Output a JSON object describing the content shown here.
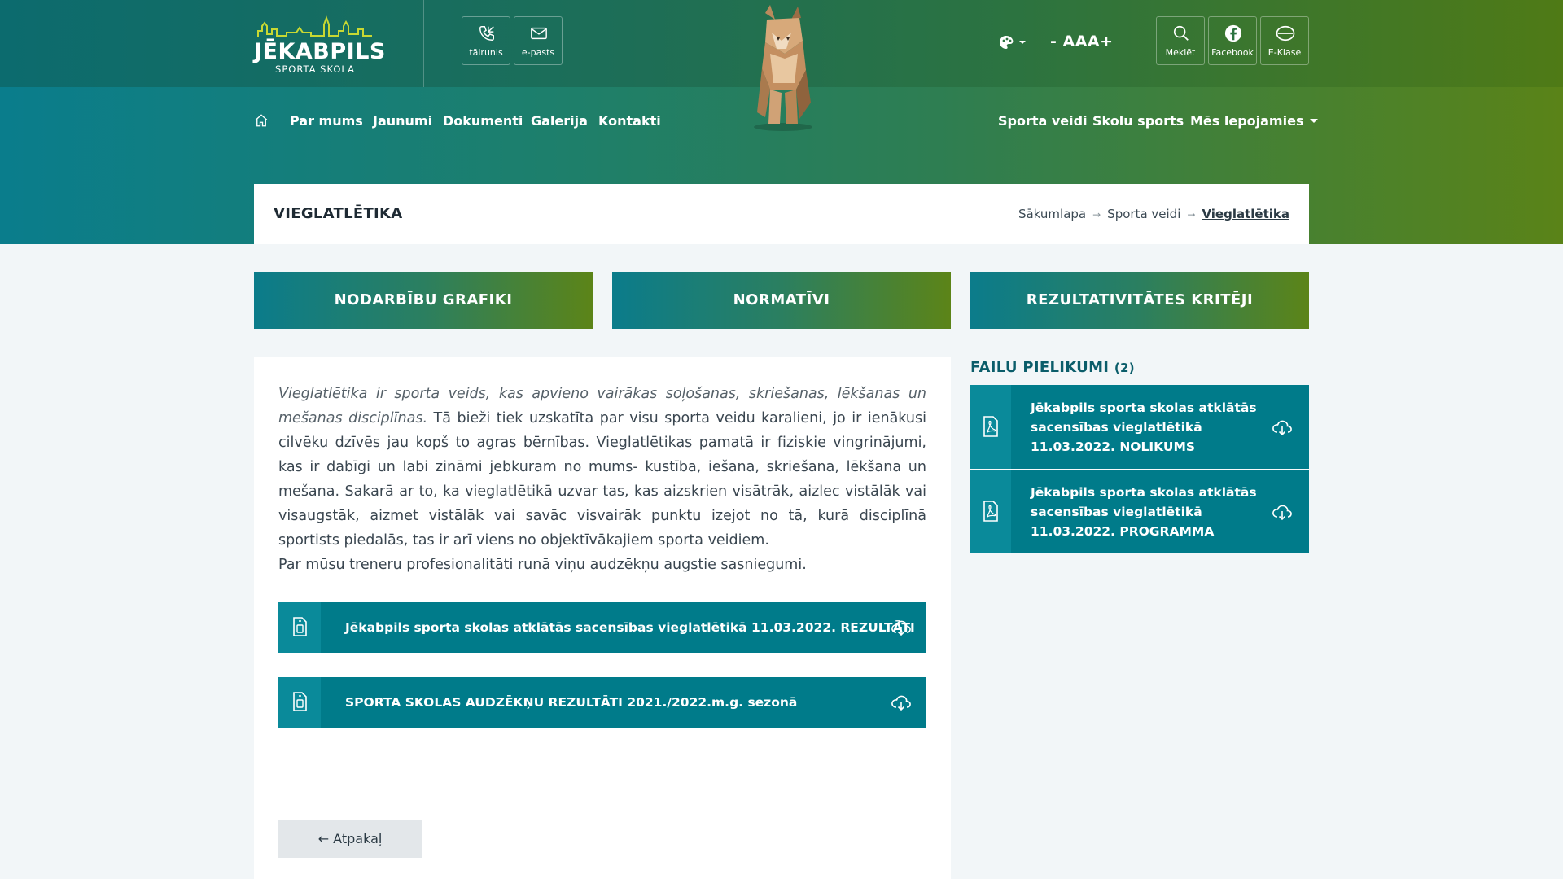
{
  "header": {
    "logo_name": "JĒKABPILS",
    "logo_sub": "SPORTA SKOLA",
    "contact_buttons": [
      {
        "label": "tālrunis",
        "icon": "phone-icon"
      },
      {
        "label": "e-pasts",
        "icon": "mail-icon"
      }
    ],
    "font_size_label": "- AAA+",
    "right_buttons": [
      {
        "label": "Meklēt",
        "icon": "search-icon"
      },
      {
        "label": "Facebook",
        "icon": "facebook-icon"
      },
      {
        "label": "E-Klase",
        "icon": "e-klase-icon"
      }
    ]
  },
  "nav": {
    "left": [
      "Par mums",
      "Jaunumi",
      "Dokumenti",
      "Galerija",
      "Kontakti"
    ],
    "right": [
      "Sporta veidi",
      "Skolu sports",
      "Mēs lepojamies"
    ]
  },
  "page": {
    "title": "VIEGLATLĒTIKA",
    "breadcrumb": [
      "Sākumlapa",
      "Sporta veidi",
      "Vieglatlētika"
    ]
  },
  "tabs": [
    "NODARBĪBU GRAFIKI",
    "NORMATĪVI",
    "REZULTATIVITĀTES KRITĒJI"
  ],
  "content": {
    "intro_italic": "Vieglatlētika ir sporta veids, kas apvieno vairākas soļošanas, skriešanas, lēkšanas un mešanas disciplīnas.",
    "intro_rest": " Tā bieži tiek uzskatīta par visu sporta veidu karalieni, jo ir ienākusi cilvēku dzīvēs jau kopš to agras bērnības. Vieglatlētikas pamatā ir fiziskie vingrinājumi, kas ir dabīgi un labi zināmi jebkuram no mums- kustība, iešana, skriešana, lēkšana un mešana. Sakarā ar to, ka vieglatlētikā uzvar tas, kas aizskrien visātrāk, aizlec vistālāk vai visaugstāk, aizmet vistālāk vai savāc visvairāk punktu izejot no tā, kurā disciplīnā sportists piedalās, tas ir arī viens no objektīvākajiem sporta veidiem.",
    "paragraph2": "Par mūsu treneru profesionalitāti runā viņu audzēkņu augstie sasniegumi.",
    "files": [
      "Jēkabpils sporta skolas atklātās sacensības vieglatlētikā 11.03.2022. REZULTĀTI",
      "SPORTA SKOLAS AUDZĒKŅU REZULTĀTI 2021./2022.m.g. sezonā"
    ],
    "back_label": "← Atpakaļ"
  },
  "attachments": {
    "title": "FAILU PIELIKUMI",
    "count": "(2)",
    "items": [
      "Jēkabpils sporta skolas atklātās sacensības vieglatlētikā 11.03.2022. NOLIKUMS",
      "Jēkabpils sporta skolas atklātās sacensības vieglatlētikā 11.03.2022. PROGRAMMA"
    ]
  },
  "colors": {
    "teal": "#007b8a",
    "green": "#5c8418",
    "dark_title": "#0b5d6a"
  }
}
